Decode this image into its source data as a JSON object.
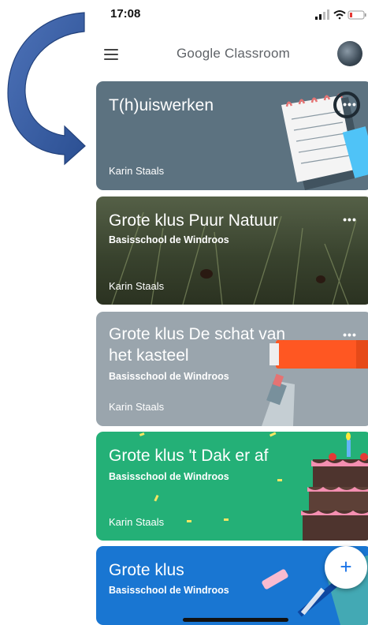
{
  "status_bar": {
    "time": "17:08"
  },
  "app_bar": {
    "title": "Google Classroom",
    "menu_icon": "hamburger-menu-icon",
    "avatar": "user-avatar"
  },
  "classes": [
    {
      "title": "T(h)uiswerken",
      "subtitle": "",
      "owner": "Karin Staals",
      "theme": "#5c7280"
    },
    {
      "title": "Grote klus Puur Natuur",
      "subtitle": "Basisschool de Windroos",
      "owner": "Karin Staals",
      "theme": "#3e4733"
    },
    {
      "title_line1": "Grote klus De schat van",
      "title_line2": "het kasteel",
      "subtitle": "Basisschool de Windroos",
      "owner": "Karin Staals",
      "theme": "#9aa5ad"
    },
    {
      "title": "Grote klus 't Dak er af",
      "subtitle": "Basisschool de Windroos",
      "owner": "Karin Staals",
      "theme": "#24b077"
    },
    {
      "title": "Grote klus",
      "subtitle": "Basisschool de Windroos",
      "theme": "#1976d2"
    }
  ],
  "fab": {
    "label": "+"
  },
  "annotation": {
    "color": "#3a5fa8",
    "icon": "curved-arrow-annotation"
  }
}
